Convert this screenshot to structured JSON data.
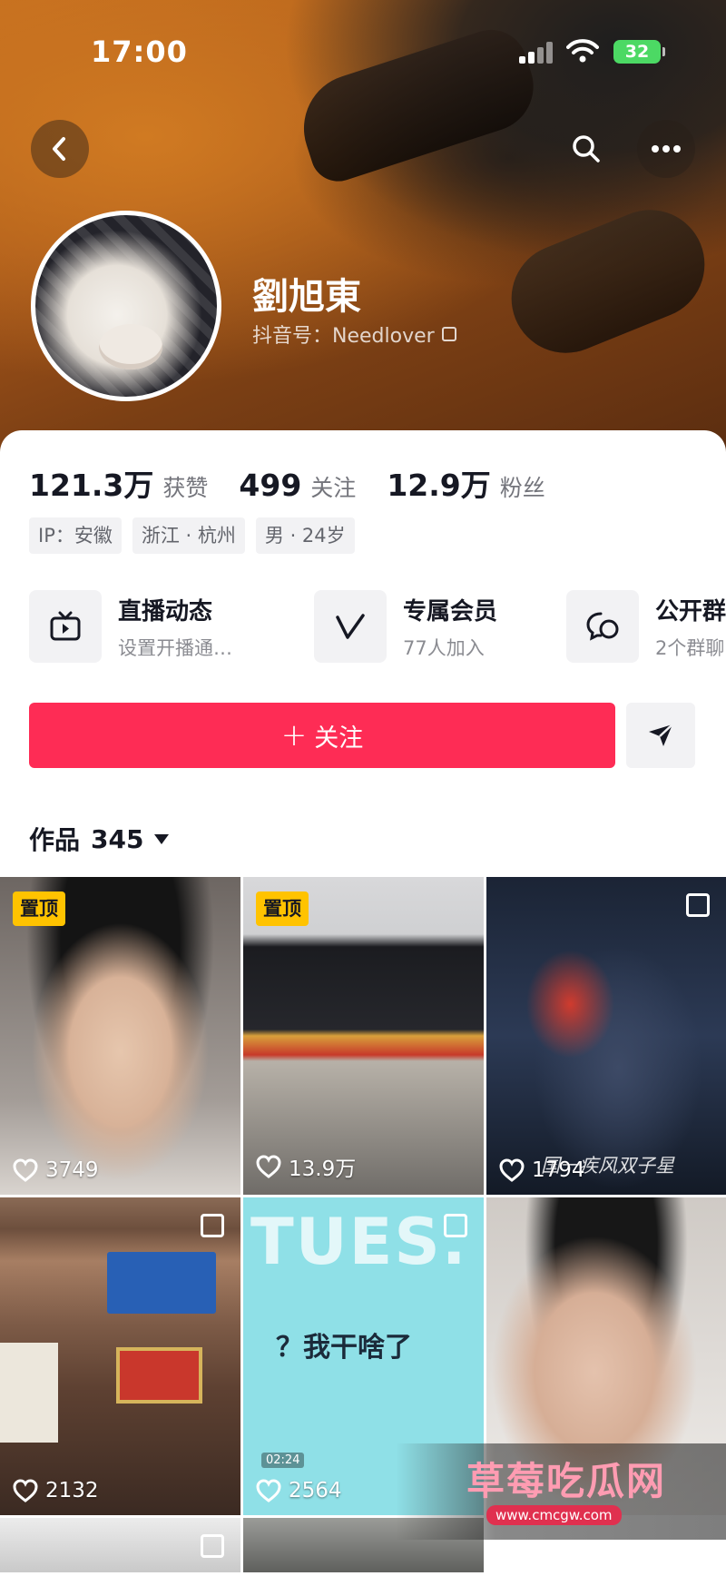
{
  "status_bar": {
    "time": "17:00",
    "battery": "32"
  },
  "profile": {
    "name": "劉旭東",
    "douyin_id": "抖音号：Needlover"
  },
  "stats": [
    {
      "value": "121.3万",
      "label": "获赞"
    },
    {
      "value": "499",
      "label": "关注"
    },
    {
      "value": "12.9万",
      "label": "粉丝"
    }
  ],
  "tags": [
    "IP：安徽",
    "浙江 · 杭州",
    "男 · 24岁"
  ],
  "features": [
    {
      "title": "直播动态",
      "subtitle": "设置开播通…",
      "icon": "tv-icon"
    },
    {
      "title": "专属会员",
      "subtitle": "77人加入",
      "icon": "vip-icon"
    },
    {
      "title": "公开群",
      "subtitle": "2个群聊",
      "icon": "chat-icon"
    }
  ],
  "actions": {
    "follow_label": "关注",
    "follow_prefix": "+"
  },
  "works": {
    "label": "作品",
    "count": "345"
  },
  "videos": [
    {
      "pinned_label": "置顶",
      "likes": "3749"
    },
    {
      "pinned_label": "置顶",
      "likes": "13.9万"
    },
    {
      "likes": "1794",
      "overlay_text": "国一疾风双子星"
    },
    {
      "likes": "2132"
    },
    {
      "likes": "2564",
      "big_text": "TUES.",
      "caption": "？我干啥了",
      "duration": "02:24"
    },
    {
      "likes": ""
    }
  ],
  "watermark": {
    "title": "草莓吃瓜网",
    "url": "www.cmcgw.com"
  },
  "colors": {
    "accent": "#fe2c55",
    "pin": "#ffc300",
    "battery": "#4cd964"
  }
}
